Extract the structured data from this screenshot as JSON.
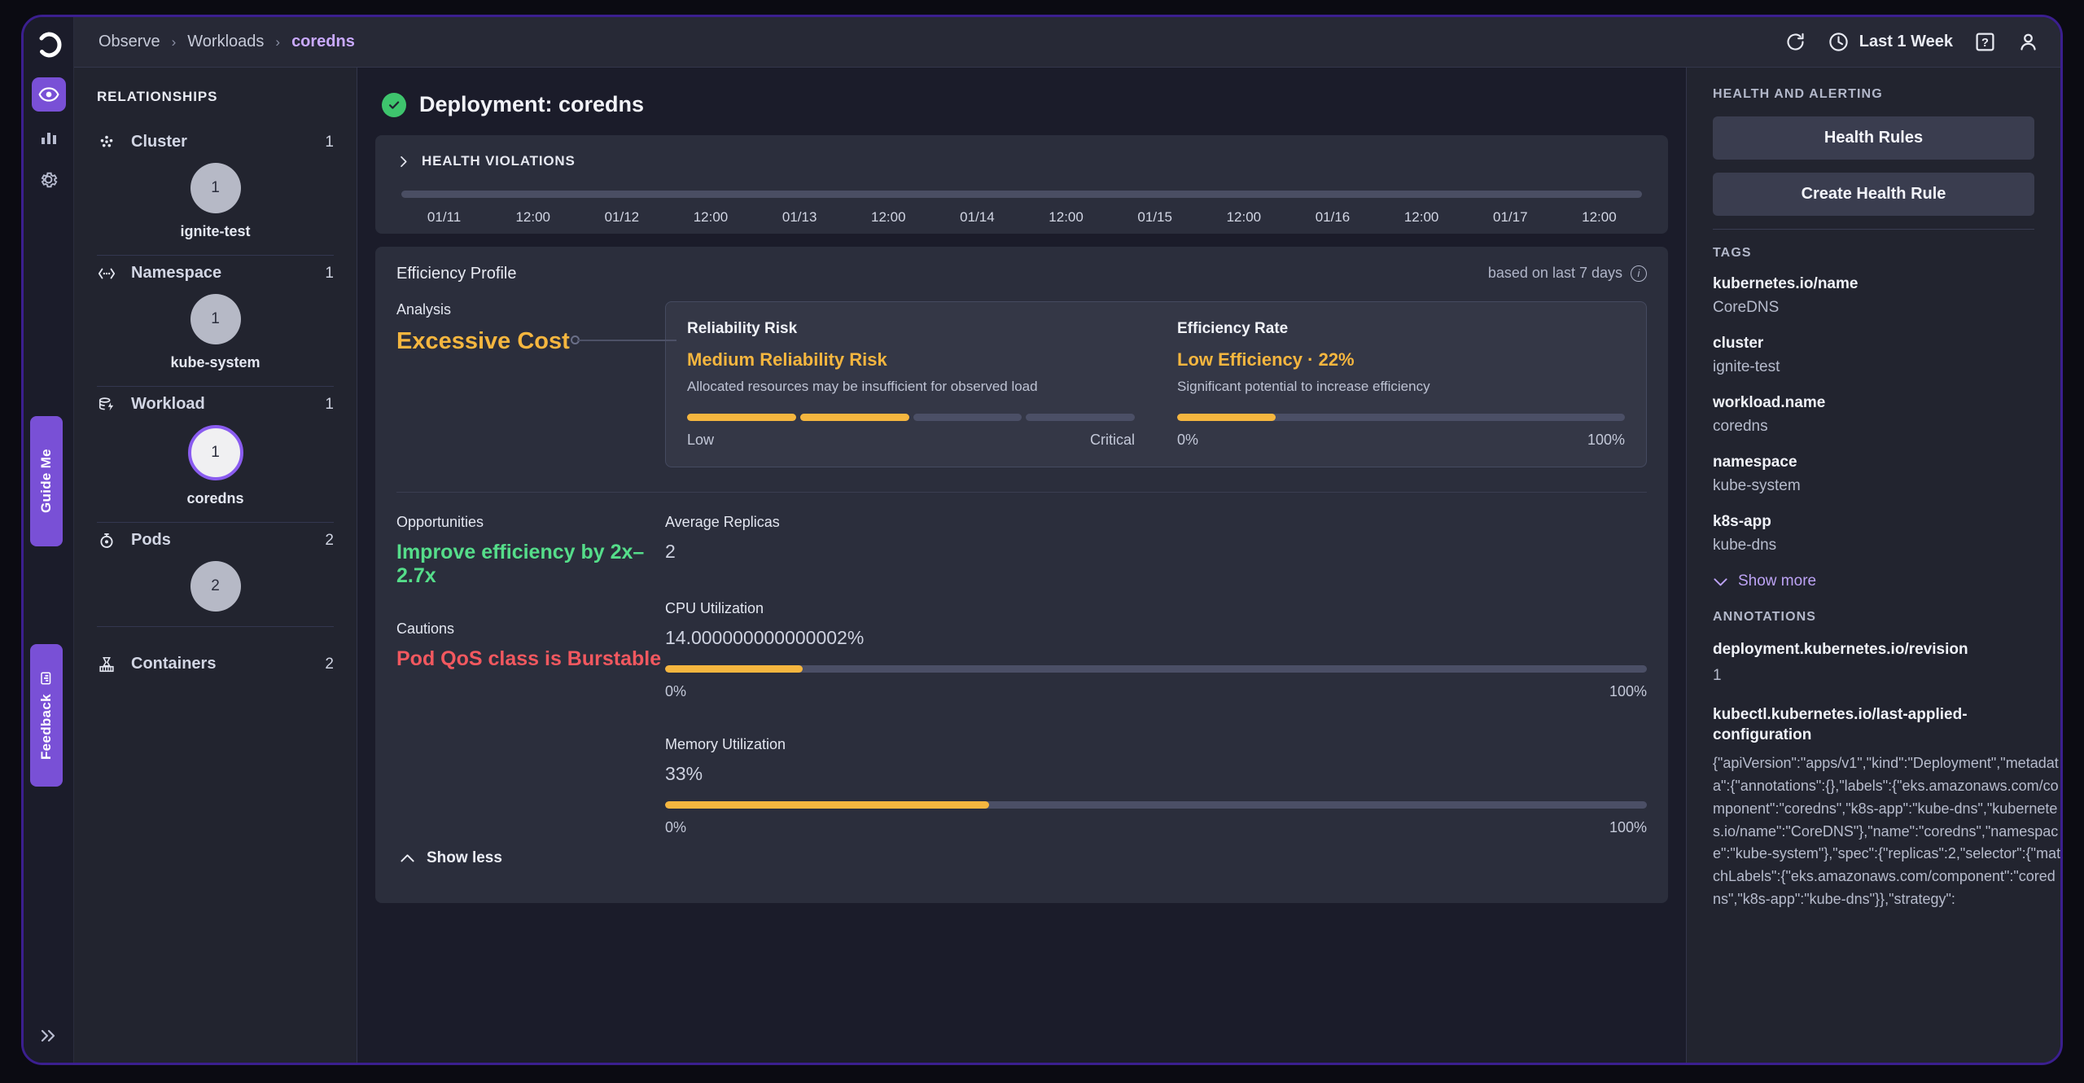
{
  "rail": {
    "logo_icon": "ignite-logo-icon",
    "items": [
      {
        "icon": "eye-icon",
        "name": "observe",
        "active": true
      },
      {
        "icon": "bar-chart-icon",
        "name": "analytics",
        "active": false
      },
      {
        "icon": "gear-icon",
        "name": "settings",
        "active": false
      }
    ],
    "guide_me": "Guide Me",
    "feedback": "Feedback",
    "expand_icon": "double-chevron-right-icon"
  },
  "topbar": {
    "breadcrumb": [
      "Observe",
      "Workloads",
      "coredns"
    ],
    "separator": "›",
    "refresh_icon": "refresh-icon",
    "clock_icon": "clock-icon",
    "time_range": "Last 1 Week",
    "help_icon": "help-icon",
    "user_icon": "user-icon"
  },
  "relationships": {
    "title": "RELATIONSHIPS",
    "groups": [
      {
        "icon": "cluster-icon",
        "label": "Cluster",
        "count": "1",
        "node_value": "1",
        "node_name": "ignite-test",
        "selected": false
      },
      {
        "icon": "namespace-icon",
        "label": "Namespace",
        "count": "1",
        "node_value": "1",
        "node_name": "kube-system",
        "selected": false
      },
      {
        "icon": "workload-icon",
        "label": "Workload",
        "count": "1",
        "node_value": "1",
        "node_name": "coredns",
        "selected": true
      },
      {
        "icon": "pods-icon",
        "label": "Pods",
        "count": "2",
        "node_value": "2",
        "node_name": "",
        "selected": false
      },
      {
        "icon": "containers-icon",
        "label": "Containers",
        "count": "2",
        "node_value": "",
        "node_name": "",
        "selected": false
      }
    ]
  },
  "page": {
    "status_icon": "check-circle-icon",
    "title": "Deployment: coredns"
  },
  "health_violations": {
    "chevron_icon": "chevron-right-icon",
    "title": "HEALTH VIOLATIONS",
    "ticks": [
      "01/11",
      "12:00",
      "01/12",
      "12:00",
      "01/13",
      "12:00",
      "01/14",
      "12:00",
      "01/15",
      "12:00",
      "01/16",
      "12:00",
      "01/17",
      "12:00"
    ]
  },
  "efficiency_profile": {
    "title": "Efficiency Profile",
    "note": "based on last 7 days",
    "info_icon": "info-icon",
    "analysis_label": "Analysis",
    "analysis_value": "Excessive Cost",
    "reliability": {
      "title": "Reliability Risk",
      "value": "Medium Reliability Risk",
      "subtitle": "Allocated resources may be insufficient for observed load",
      "segments_total": 4,
      "segments_filled": 2,
      "scale_min": "Low",
      "scale_max": "Critical"
    },
    "efficiency_rate": {
      "title": "Efficiency Rate",
      "value": "Low Efficiency · 22%",
      "subtitle": "Significant potential to increase efficiency",
      "percent": 22,
      "scale_min": "0%",
      "scale_max": "100%"
    },
    "opportunities_label": "Opportunities",
    "opportunities_value": "Improve efficiency by 2x–2.7x",
    "cautions_label": "Cautions",
    "cautions_value": "Pod QoS class is Burstable",
    "average_replicas_label": "Average Replicas",
    "average_replicas_value": "2",
    "cpu": {
      "label": "CPU Utilization",
      "value": "14.000000000000002%",
      "percent": 14,
      "scale_min": "0%",
      "scale_max": "100%"
    },
    "memory": {
      "label": "Memory Utilization",
      "value": "33%",
      "percent": 33,
      "scale_min": "0%",
      "scale_max": "100%"
    },
    "show_less": "Show less",
    "show_less_icon": "chevron-up-icon"
  },
  "right_sidebar": {
    "health_section_title": "HEALTH AND ALERTING",
    "health_rules_button": "Health Rules",
    "create_health_rule_button": "Create Health Rule",
    "tags_title": "TAGS",
    "tags": [
      {
        "key": "kubernetes.io/name",
        "value": "CoreDNS"
      },
      {
        "key": "cluster",
        "value": "ignite-test"
      },
      {
        "key": "workload.name",
        "value": "coredns"
      },
      {
        "key": "namespace",
        "value": "kube-system"
      },
      {
        "key": "k8s-app",
        "value": "kube-dns"
      }
    ],
    "show_more": "Show more",
    "show_more_icon": "chevron-down-icon",
    "annotations_title": "ANNOTATIONS",
    "annotations": [
      {
        "key": "deployment.kubernetes.io/revision",
        "value": "1"
      }
    ],
    "last_applied_key": "kubectl.kubernetes.io/last-applied-configuration",
    "last_applied_value": "{\"apiVersion\":\"apps/v1\",\"kind\":\"Deployment\",\"metadata\":{\"annotations\":{},\"labels\":{\"eks.amazonaws.com/component\":\"coredns\",\"k8s-app\":\"kube-dns\",\"kubernetes.io/name\":\"CoreDNS\"},\"name\":\"coredns\",\"namespace\":\"kube-system\"},\"spec\":{\"replicas\":2,\"selector\":{\"matchLabels\":{\"eks.amazonaws.com/component\":\"coredns\",\"k8s-app\":\"kube-dns\"}},\"strategy\":"
  },
  "colors": {
    "accent_purple": "#7950d6",
    "amber": "#f5b63f",
    "green": "#55dd8a",
    "red": "#f2585f",
    "link_purple": "#bda3f5"
  }
}
